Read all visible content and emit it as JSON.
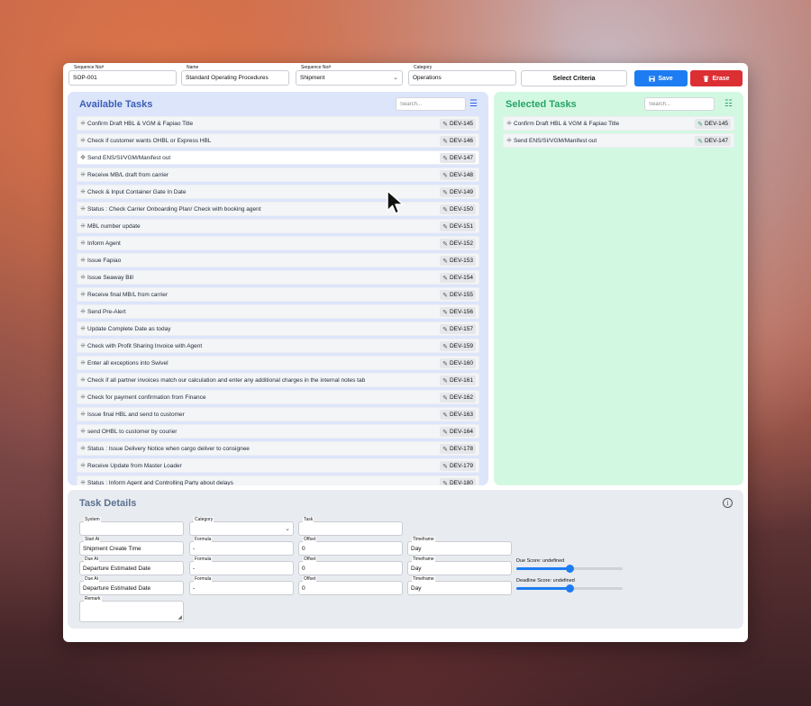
{
  "top": {
    "sequence_no": {
      "label": "Sequence No#",
      "value": "SOP-001"
    },
    "name": {
      "label": "Name",
      "value": "Standard Operating Procedures"
    },
    "sequence_select": {
      "label": "Sequence No#",
      "value": "Shipment"
    },
    "category": {
      "label": "Category",
      "value": "Operations"
    },
    "select_criteria": "Select Criteria",
    "save": "Save",
    "erase": "Erase"
  },
  "available": {
    "title": "Available Tasks",
    "search_placeholder": "Search...",
    "highlighted_index": 2,
    "items": [
      {
        "label": "Confirm Draft HBL & VGM & Fapiao Title",
        "tag": "DEV-145"
      },
      {
        "label": "Check if customer wants OHBL or Express HBL",
        "tag": "DEV-146"
      },
      {
        "label": "Send ENS/SI/VGM/Manifest out",
        "tag": "DEV-147"
      },
      {
        "label": "Receive MB/L draft from carrier",
        "tag": "DEV-148"
      },
      {
        "label": "Check & Input Container Gate In Date",
        "tag": "DEV-149"
      },
      {
        "label": "Status : Check Carrier Onboarding Plan/ Check with booking agent",
        "tag": "DEV-150"
      },
      {
        "label": "MBL number update",
        "tag": "DEV-151"
      },
      {
        "label": "Inform Agent",
        "tag": "DEV-152"
      },
      {
        "label": "Issue Fapiao",
        "tag": "DEV-153"
      },
      {
        "label": "Issue Seaway Bill",
        "tag": "DEV-154"
      },
      {
        "label": "Receive final MB/L from carrier",
        "tag": "DEV-155"
      },
      {
        "label": "Send Pre-Alert",
        "tag": "DEV-156"
      },
      {
        "label": "Update Complete Date as today",
        "tag": "DEV-157"
      },
      {
        "label": "Check with Profit Sharing Invoice with Agent",
        "tag": "DEV-159"
      },
      {
        "label": "Enter all exceptions into Swivel",
        "tag": "DEV-160"
      },
      {
        "label": "Check if all partner invoices match our calculation and enter any additional charges in the internal notes tab",
        "tag": "DEV-161"
      },
      {
        "label": "Check for payment confirmation from Finance",
        "tag": "DEV-162"
      },
      {
        "label": "Issue final HBL and send to customer",
        "tag": "DEV-163"
      },
      {
        "label": "send OHBL to customer by courier",
        "tag": "DEV-164"
      },
      {
        "label": "Status : Issue Delivery Notice when cargo deliver to consignee",
        "tag": "DEV-178"
      },
      {
        "label": "Receive Update from Master Loader",
        "tag": "DEV-179"
      },
      {
        "label": "Status : Inform Agent and Controlling Party about delays",
        "tag": "DEV-180"
      }
    ]
  },
  "selected": {
    "title": "Selected Tasks",
    "search_placeholder": "Search...",
    "items": [
      {
        "label": "Confirm Draft HBL & VGM & Fapiao Title",
        "tag": "DEV-145"
      },
      {
        "label": "Send ENS/SI/VGM/Manifest out",
        "tag": "DEV-147"
      }
    ]
  },
  "details": {
    "title": "Task Details",
    "system": {
      "label": "System",
      "value": ""
    },
    "category": {
      "label": "Category",
      "value": ""
    },
    "task": {
      "label": "Task",
      "value": ""
    },
    "rows": [
      {
        "a_label": "Start At",
        "a_value": "Shipment Create Time",
        "formula_label": "Formula",
        "formula": "-",
        "offset_label": "Offset",
        "offset": "0",
        "timeframe_label": "Timeframe",
        "timeframe": "Day"
      },
      {
        "a_label": "Due At",
        "a_value": "Departure Estimated Date",
        "formula_label": "Formula",
        "formula": "-",
        "offset_label": "Offset",
        "offset": "0",
        "timeframe_label": "Timeframe",
        "timeframe": "Day"
      },
      {
        "a_label": "Due At",
        "a_value": "Departure Estimated Date",
        "formula_label": "Formula",
        "formula": "-",
        "offset_label": "Offset",
        "offset": "0",
        "timeframe_label": "Timeframe",
        "timeframe": "Day"
      }
    ],
    "due_score": {
      "label": "Due Score: undefined",
      "level": 0.5
    },
    "deadline_score": {
      "label": "Deadline Score: undefined",
      "level": 0.5
    },
    "remark": {
      "label": "Remark",
      "value": ""
    }
  },
  "colors": {
    "accent": "#1d7cf2",
    "danger": "#dc2f34",
    "available_bg": "#dde5fb",
    "selected_bg": "#d3f8e2"
  }
}
